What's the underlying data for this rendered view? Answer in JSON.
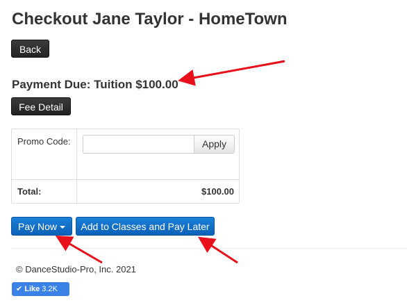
{
  "page": {
    "title": "Checkout Jane Taylor - HomeTown"
  },
  "buttons": {
    "back": "Back",
    "fee_detail": "Fee Detail",
    "pay_now": "Pay Now",
    "add_to_classes": "Add to Classes and Pay Later"
  },
  "payment": {
    "due_text": "Payment Due: Tuition $100.00"
  },
  "promo": {
    "label": "Promo Code:",
    "value": "",
    "placeholder": "",
    "apply_label": "Apply"
  },
  "totals": {
    "label": "Total:",
    "value": "$100.00"
  },
  "footer": {
    "copyright": "© DanceStudio-Pro, Inc. 2021"
  },
  "like": {
    "label": "Like",
    "count": "3.2K"
  },
  "colors": {
    "primary_button": "#0d62b8",
    "dark_button": "#222222",
    "annotation_arrow": "#e8101a",
    "like_button": "#3b82e6"
  },
  "icons": {
    "pay_now_caret": "caret-down-icon",
    "like_check": "check-icon"
  }
}
